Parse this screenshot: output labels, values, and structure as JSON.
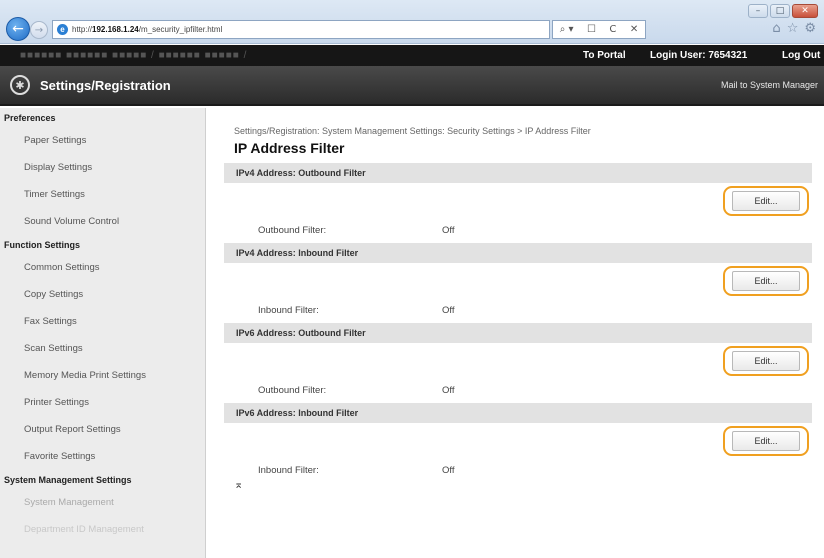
{
  "browser": {
    "url_prefix": "http://",
    "url_host": "192.168.1.24",
    "url_path": "/m_security_ipfilter.html",
    "addr_tools": [
      "⌕ ▾",
      "☐",
      "C",
      "✕"
    ],
    "fav_icons": [
      "⌂",
      "☆",
      "⚙"
    ]
  },
  "topbar": {
    "model_text": "■■■■■■  ■■■■■■ ■■■■■ / ■■■■■■ ■■■■■ /",
    "to_portal": "To Portal",
    "login_user": "Login User:  7654321",
    "log_out": "Log Out"
  },
  "header": {
    "title": "Settings/Registration",
    "mail": "Mail to System Manager"
  },
  "sidebar": {
    "sections": [
      {
        "heading": "Preferences",
        "items": [
          "Paper Settings",
          "Display Settings",
          "Timer Settings",
          "Sound Volume Control"
        ]
      },
      {
        "heading": "Function Settings",
        "items": [
          "Common Settings",
          "Copy Settings",
          "Fax Settings",
          "Scan Settings",
          "Memory Media Print Settings",
          "Printer Settings",
          "Output Report Settings",
          "Favorite Settings"
        ]
      },
      {
        "heading": "System Management Settings",
        "items": [
          "System Management",
          "Department ID Management"
        ]
      }
    ]
  },
  "main": {
    "breadcrumb": "Settings/Registration: System Management Settings: Security Settings > IP Address Filter",
    "title": "IP Address Filter",
    "edit_label": "Edit...",
    "sections": [
      {
        "heading": "IPv4 Address: Outbound Filter",
        "label": "Outbound Filter:",
        "value": "Off"
      },
      {
        "heading": "IPv4 Address: Inbound Filter",
        "label": "Inbound Filter:",
        "value": "Off"
      },
      {
        "heading": "IPv6 Address: Outbound Filter",
        "label": "Outbound Filter:",
        "value": "Off"
      },
      {
        "heading": "IPv6 Address: Inbound Filter",
        "label": "Inbound Filter:",
        "value": "Off"
      }
    ],
    "to_top": "⌅"
  },
  "colors": {
    "highlight": "#f0a020",
    "titlebar": "#333333",
    "topbar": "#161616"
  }
}
